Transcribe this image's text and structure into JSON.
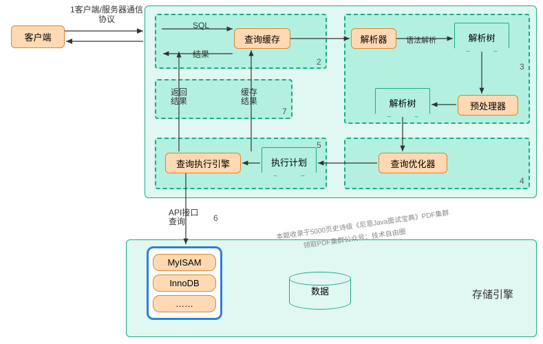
{
  "client": "客户端",
  "protocol_label": "1客户端/服务器通信协议",
  "main": {
    "sql": "SQL",
    "result": "结果",
    "query_cache": "查询缓存",
    "parser": "解析器",
    "syntax_parse": "语法解析",
    "parse_tree": "解析树",
    "preprocessor": "预处理器",
    "optimizer": "查询优化器",
    "exec_plan": "执行计划",
    "exec_engine": "查询执行引擎",
    "return_result": "返回结果",
    "cache_result": "缓存结果",
    "n2": "2",
    "n3": "3",
    "n4": "4",
    "n5": "5",
    "n7": "7"
  },
  "api_label": "API接口查询",
  "n6": "6",
  "storage": {
    "title": "存储引擎",
    "engines": [
      "MyISAM",
      "InnoDB",
      "……"
    ],
    "data": "数据"
  },
  "watermark1": "本题收录于5000页史诗级《尼恩Java面试宝典》PDF集群",
  "watermark2": "领取PDF集群公众号：技术自由圈"
}
